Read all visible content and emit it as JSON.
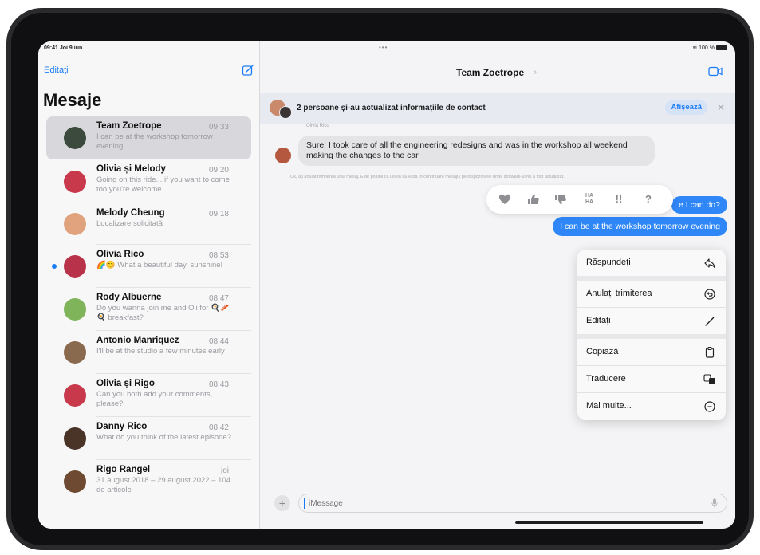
{
  "status": {
    "time_date": "09:41 Joi 9 iun.",
    "dots": "•••",
    "battery": "100 %"
  },
  "sidebar": {
    "edit_label": "Editați",
    "compose_icon": "compose-icon",
    "title": "Mesaje",
    "conversations": [
      {
        "name": "Team Zoetrope",
        "time": "09:33",
        "preview": "I can be at the workshop tomorrow evening",
        "selected": true,
        "avatar_color": "#3b4a3c"
      },
      {
        "name": "Olivia și Melody",
        "time": "09:20",
        "preview": "Going on this ride... if you want to come too you're welcome",
        "avatar_color": "#c7394b"
      },
      {
        "name": "Melody Cheung",
        "time": "09:18",
        "preview": "Localizare solicitată",
        "avatar_color": "#e0a37d"
      },
      {
        "name": "Olivia Rico",
        "time": "08:53",
        "preview": "🌈😊 What a beautiful day, sunshine!",
        "unread": true,
        "avatar_color": "#b8324a"
      },
      {
        "name": "Rody Albuerne",
        "time": "08:47",
        "preview": "Do you wanna join me and Oli for 🍳🥓🍳 breakfast?",
        "avatar_color": "#7fb45a"
      },
      {
        "name": "Antonio Manriquez",
        "time": "08:44",
        "preview": "I'll be at the studio a few minutes early",
        "avatar_color": "#8a6a4e"
      },
      {
        "name": "Olivia și Rigo",
        "time": "08:43",
        "preview": "Can you both add your comments, please?",
        "avatar_color": "#c7394b"
      },
      {
        "name": "Danny Rico",
        "time": "08:42",
        "preview": "What do you think of the latest episode?",
        "avatar_color": "#4a3428"
      },
      {
        "name": "Rigo Rangel",
        "time": "joi",
        "preview": "31 august 2018 – 29 august 2022 – 104 de articole",
        "avatar_color": "#6e4a32"
      }
    ]
  },
  "main": {
    "title": "Team Zoetrope",
    "title_chevron": "›",
    "banner_text": "2 persoane și-au actualizat informațiile de contact",
    "banner_button": "Afișează",
    "banner_close": "✕",
    "sender_label": "Olivia Rico",
    "incoming_message": "Sure! I took care of all the engineering redesigns and was in the workshop all weekend making the changes to the car",
    "notice": "Ok, ați anulat trimiterea unui mesaj. Este posibil ca Olivia să vadă în continuare mesajul pe dispozitivele unde software-ul nu a fost actualizat.",
    "outgoing_1": "e I can do?",
    "outgoing_2_prefix": "I can be at the workshop ",
    "outgoing_2_link": "tomorrow evening",
    "tapbacks": [
      "heart-icon",
      "thumbs-up-icon",
      "thumbs-down-icon",
      "haha-icon",
      "exclamation-icon",
      "question-icon"
    ],
    "tapback_labels": {
      "haha": "HA HA",
      "exclaim": "!!",
      "question": "?"
    },
    "context_menu": [
      {
        "label": "Răspundeți",
        "icon": "reply-icon"
      },
      {
        "label": "Anulați trimiterea",
        "icon": "undo-send-icon"
      },
      {
        "label": "Editați",
        "icon": "pencil-icon"
      },
      {
        "label": "Copiază",
        "icon": "copy-icon"
      },
      {
        "label": "Traducere",
        "icon": "translate-icon"
      },
      {
        "label": "Mai multe...",
        "icon": "more-icon"
      }
    ],
    "input_placeholder": "iMessage",
    "plus_label": "+"
  }
}
